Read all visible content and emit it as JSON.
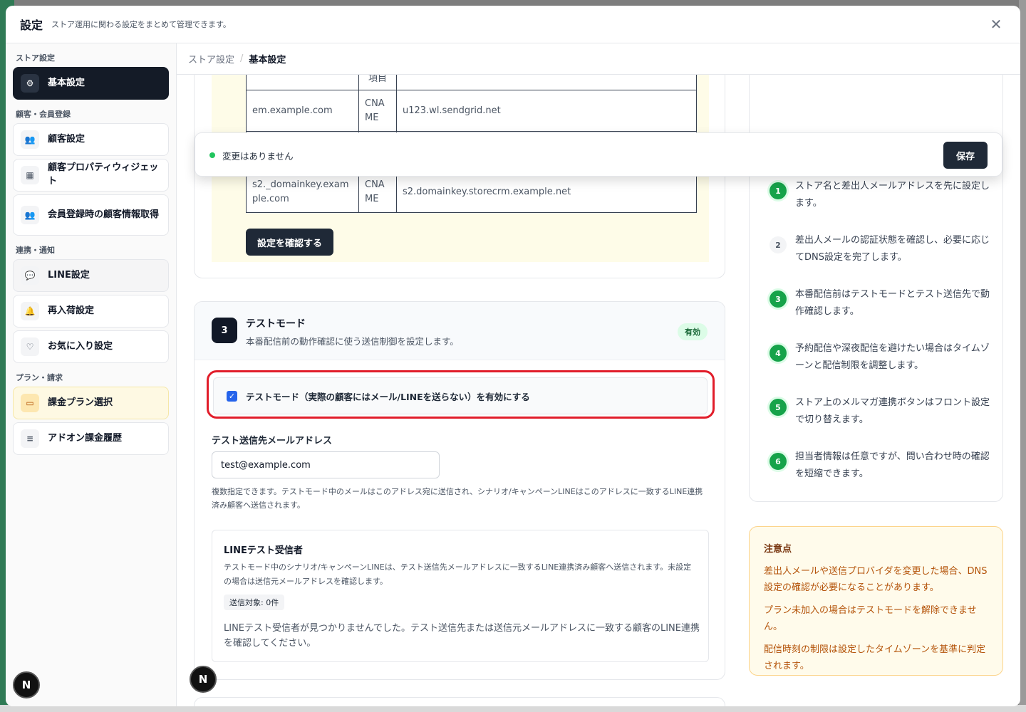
{
  "modal": {
    "title": "設定",
    "subtitle": "ストア運用に関わる設定をまとめて管理できます。",
    "close_icon": "close-icon",
    "close_glyph": "✕"
  },
  "sidebar": {
    "groups": [
      {
        "label": "ストア設定",
        "items": [
          {
            "label": "基本設定",
            "icon": "gear-icon",
            "glyph": "⚙",
            "state": "active"
          }
        ]
      },
      {
        "label": "顧客・会員登録",
        "items": [
          {
            "label": "顧客設定",
            "icon": "users-icon",
            "glyph": "👥"
          },
          {
            "label": "顧客プロパティウィジェット",
            "icon": "grid-icon",
            "glyph": "▦"
          },
          {
            "label": "会員登録時の顧客情報取得",
            "icon": "users-icon",
            "glyph": "👥"
          }
        ]
      },
      {
        "label": "連携・通知",
        "items": [
          {
            "label": "LINE設定",
            "icon": "chat-icon",
            "glyph": "💬",
            "state": "hover"
          },
          {
            "label": "再入荷設定",
            "icon": "bell-icon",
            "glyph": "🔔"
          },
          {
            "label": "お気に入り設定",
            "icon": "heart-icon",
            "glyph": "♡"
          }
        ]
      },
      {
        "label": "プラン・請求",
        "items": [
          {
            "label": "課金プラン選択",
            "icon": "credit-card-icon",
            "glyph": "▭",
            "state": "warn"
          },
          {
            "label": "アドオン課金履歴",
            "icon": "database-icon",
            "glyph": "≡"
          }
        ]
      }
    ]
  },
  "breadcrumb": {
    "parent": "ストア設定",
    "separator": "/",
    "current": "基本設定"
  },
  "dns_table": {
    "header_fragment": "項目",
    "rows": [
      {
        "host": "em.example.com",
        "type": "CNAME",
        "value": "u123.wl.sendgrid.net"
      },
      {
        "host": "",
        "type": "",
        "value": ""
      },
      {
        "host": "s2._domainkey.example.com",
        "type": "CNAME",
        "value": "s2.domainkey.storecrm.example.net"
      }
    ],
    "confirm_label": "設定を確認する"
  },
  "test_mode": {
    "step": "3",
    "title": "テストモード",
    "description": "本番配信前の動作確認に使う送信制御を設定します。",
    "status_badge": "有効",
    "checkbox_label": "テストモード（実際の顧客にはメール/LINEを送らない）を有効にする",
    "checkbox_checked": true,
    "email_label": "テスト送信先メールアドレス",
    "email_value": "test@example.com",
    "email_help": "複数指定できます。テストモード中のメールはこのアドレス宛に送信され、シナリオ/キャンペーンLINEはこのアドレスに一致するLINE連携済み顧客へ送信されます。",
    "line": {
      "title": "LINEテスト受信者",
      "description": "テストモード中のシナリオ/キャンペーンLINEは、テスト送信先メールアドレスに一致するLINE連携済み顧客へ送信されます。未設定の場合は送信元メールアドレスを確認します。",
      "target_count": "送信対象: 0件",
      "empty_message": "LINEテスト受信者が見つかりませんでした。テスト送信先または送信元メールアドレスに一致する顧客のLINE連携を確認してください。"
    }
  },
  "toast": {
    "status": "変更はありません",
    "save_label": "保存",
    "dot_color": "#22c55e"
  },
  "guide": {
    "steps": [
      {
        "num": "1",
        "text": "ストア名と差出人メールアドレスを先に設定します。",
        "done": true
      },
      {
        "num": "2",
        "text": "差出人メールの認証状態を確認し、必要に応じてDNS設定を完了します。",
        "done": false
      },
      {
        "num": "3",
        "text": "本番配信前はテストモードとテスト送信先で動作確認します。",
        "done": true
      },
      {
        "num": "4",
        "text": "予約配信や深夜配信を避けたい場合はタイムゾーンと配信制限を調整します。",
        "done": true
      },
      {
        "num": "5",
        "text": "ストア上のメルマガ連携ボタンはフロント設定で切り替えます。",
        "done": true
      },
      {
        "num": "6",
        "text": "担当者情報は任意ですが、問い合わせ時の確認を短縮できます。",
        "done": true
      }
    ]
  },
  "caution": {
    "title": "注意点",
    "items": [
      "差出人メールや送信プロバイダを変更した場合、DNS設定の確認が必要になることがあります。",
      "プラン未加入の場合はテストモードを解除できません。",
      "配信時刻の制限は設定したタイムゾーンを基準に判定されます。"
    ]
  },
  "dev_badge": {
    "letter": "N",
    "icon": "nextjs-logo-icon"
  },
  "colors": {
    "accent": "#111827",
    "success": "#16a34a",
    "highlight_ring": "#e11d2a",
    "warning_bg": "#fffbeb"
  }
}
